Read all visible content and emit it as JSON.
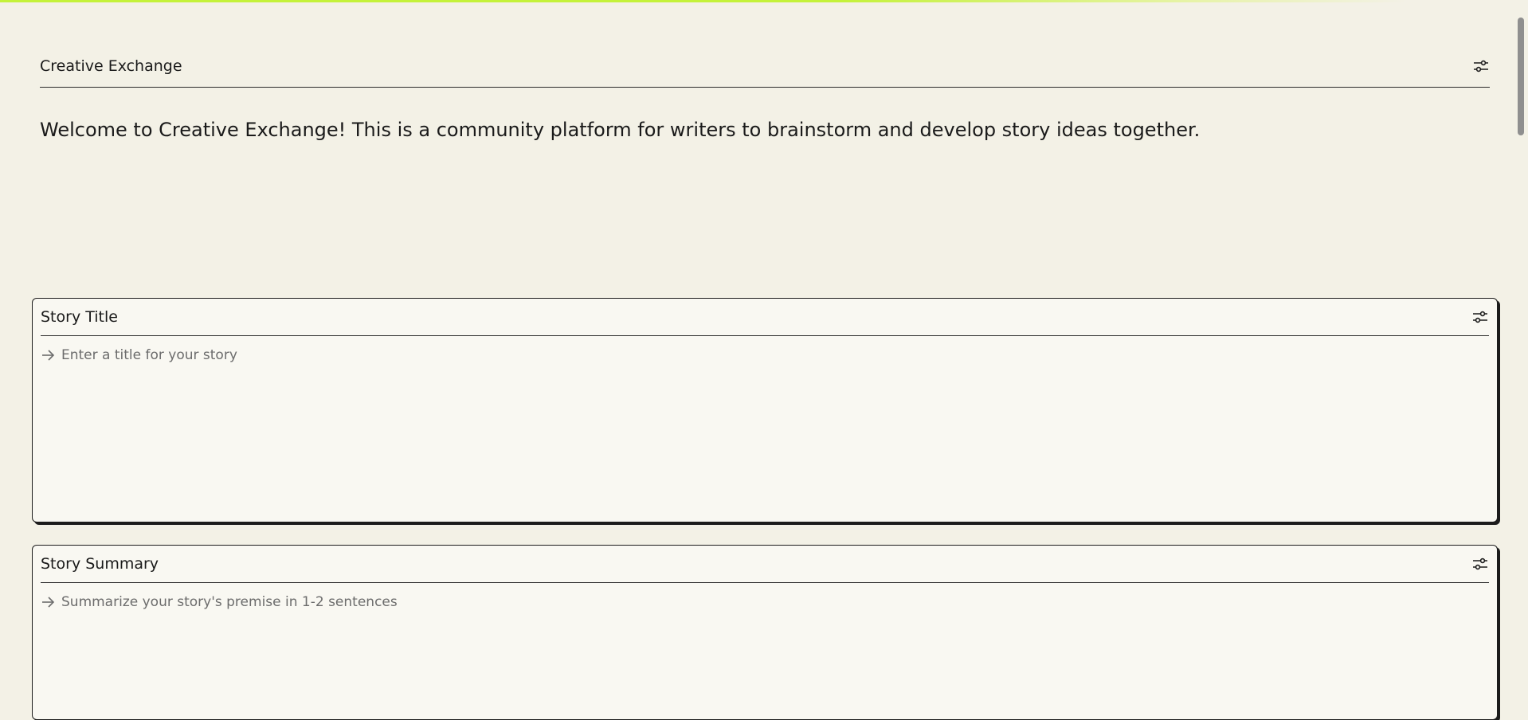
{
  "app": {
    "title": "Creative Exchange",
    "welcome_text": "Welcome to Creative Exchange! This is a community platform for writers to brainstorm and develop story ideas together."
  },
  "icons": {
    "settings": "sliders-icon",
    "arrow": "arrow-right-icon"
  },
  "colors": {
    "accent": "#c4f23a",
    "background": "#f3f1e6",
    "card_background": "#f9f8f2",
    "border": "#1c1c1c",
    "placeholder_text": "#6c6c6c"
  },
  "cards": [
    {
      "title": "Story Title",
      "placeholder": "Enter a title for your story",
      "value": ""
    },
    {
      "title": "Story Summary",
      "placeholder": "Summarize your story's premise in 1-2 sentences",
      "value": ""
    }
  ]
}
